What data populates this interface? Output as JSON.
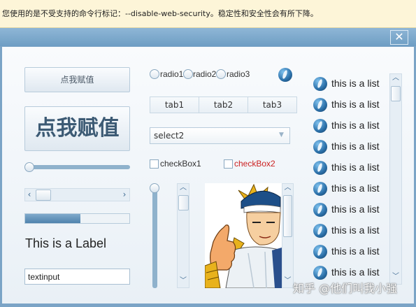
{
  "banner": {
    "text": "您使用的是不受支持的命令行标记：--disable-web-security。稳定性和安全性会有所下降。"
  },
  "window": {
    "close_glyph": "✕"
  },
  "buttons": {
    "small_label": "点我赋值",
    "big_label": "点我赋值"
  },
  "hslider": {
    "value": 0
  },
  "hscroll": {
    "left_arrow": "‹",
    "right_arrow": "›"
  },
  "progress": {
    "value": 0.53
  },
  "label": {
    "text": "This is a Label"
  },
  "textinput": {
    "value": "textinput"
  },
  "radios": [
    {
      "label": "radio1"
    },
    {
      "label": "radio2"
    },
    {
      "label": "radio3"
    }
  ],
  "tabs": [
    {
      "label": "tab1"
    },
    {
      "label": "tab2"
    },
    {
      "label": "tab3"
    }
  ],
  "select": {
    "selected": "select2",
    "arrow": "▼"
  },
  "checkboxes": [
    {
      "label": "checkBox1",
      "checked": false,
      "color": "#333333"
    },
    {
      "label": "checkBox2",
      "checked": false,
      "color": "#cc2222"
    }
  ],
  "vslider": {
    "value": 1
  },
  "scroll_arrows": {
    "up": "︿",
    "down": "﹀"
  },
  "list": {
    "items": [
      {
        "label": "this is a list",
        "icon": "o-icon"
      },
      {
        "label": "this is a list",
        "icon": "o-icon"
      },
      {
        "label": "this is a list",
        "icon": "o-icon"
      },
      {
        "label": "this is a list",
        "icon": "o-icon"
      },
      {
        "label": "this is a list",
        "icon": "o-icon"
      },
      {
        "label": "this is a list",
        "icon": "o-icon"
      },
      {
        "label": "this is a list",
        "icon": "o-icon"
      },
      {
        "label": "this is a list",
        "icon": "o-icon"
      },
      {
        "label": "this is a list",
        "icon": "o-icon"
      },
      {
        "label": "this is a list",
        "icon": "o-icon"
      }
    ]
  },
  "watermark": {
    "text": "知乎 @他们叫我小强"
  },
  "colors": {
    "accent": "#4f83ad",
    "titlebar": "#7ba4c6"
  }
}
